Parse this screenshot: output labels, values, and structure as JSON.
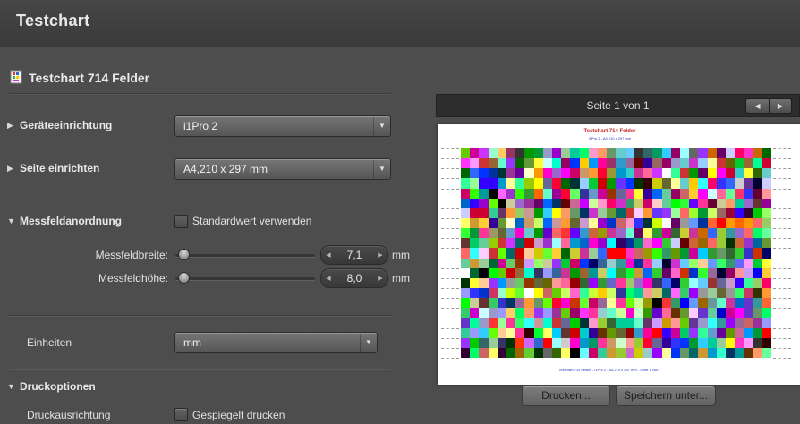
{
  "window": {
    "title": "Testchart"
  },
  "doc": {
    "title": "Testchart 714 Felder",
    "icon": "testchart-document-icon"
  },
  "icons": {
    "disclosure_closed": "▶",
    "disclosure_open": "▼",
    "dropdown_arrow": "▼",
    "stepper_left": "◀",
    "stepper_right": "▶",
    "nav_left": "◀",
    "nav_right": "▶"
  },
  "colors": {
    "background": "#4d4d4d",
    "titlebar": "#3a3a3a",
    "preview_header": "#2d2d2d",
    "page": "#ffffff"
  },
  "sections": {
    "device": {
      "label": "Geräteeinrichtung",
      "value": "i1Pro 2"
    },
    "page_setup": {
      "label": "Seite einrichten",
      "value": "A4,210 x 297 mm"
    },
    "patch_layout": {
      "label": "Messfeldanordnung",
      "default_checkbox_label": "Standardwert verwenden",
      "width": {
        "label": "Messfeldbreite:",
        "value": "7,1",
        "unit": "mm"
      },
      "height": {
        "label": "Messfeldhöhe:",
        "value": "8,0",
        "unit": "mm"
      }
    },
    "units": {
      "label": "Einheiten",
      "value": "mm"
    },
    "print_options": {
      "label": "Druckoptionen",
      "orientation_label": "Druckausrichtung",
      "mirrored_label": "Gespiegelt drucken"
    }
  },
  "preview": {
    "header": "Seite 1 von 1",
    "page_text": {
      "line1": "Testchart 714 Felder",
      "line2": "i1Pro 2 - A4,210 x 297 mm",
      "footer": "Testchart 714 Felder - i1Pro 2 - A4,210 x 297 mm - Seite 1 von 1"
    },
    "chart": {
      "rows": 21,
      "cols": 34,
      "patches": 714,
      "seed": 714
    },
    "buttons": {
      "print": "Drucken...",
      "save": "Speichern unter..."
    }
  }
}
